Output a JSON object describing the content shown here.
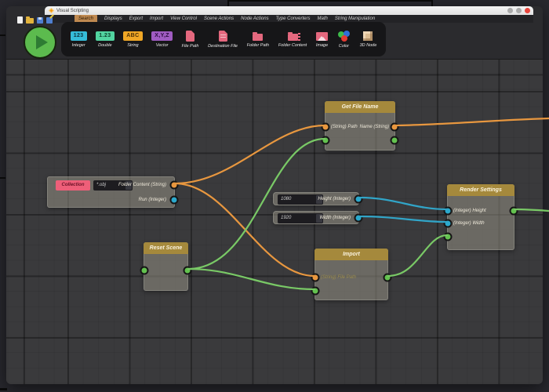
{
  "window": {
    "title": "Visual Scripting"
  },
  "menu": {
    "items": [
      {
        "label": "Search"
      },
      {
        "label": "Displays"
      },
      {
        "label": "Export"
      },
      {
        "label": "Import"
      },
      {
        "label": "View Control"
      },
      {
        "label": "Scene Actions"
      },
      {
        "label": "Node Actions"
      },
      {
        "label": "Type Converters"
      },
      {
        "label": "Math"
      },
      {
        "label": "String Manipulation"
      }
    ]
  },
  "toolbar": {
    "items": [
      {
        "label": "Integer",
        "badge": "123"
      },
      {
        "label": "Double",
        "badge": "1.23"
      },
      {
        "label": "String",
        "badge": "ABC"
      },
      {
        "label": "Vector",
        "badge": "X,Y,Z"
      },
      {
        "label": "File Path"
      },
      {
        "label": "Destination File"
      },
      {
        "label": "Folder Path"
      },
      {
        "label": "Folder Content"
      },
      {
        "label": "Image"
      },
      {
        "label": "Color"
      },
      {
        "label": "3D Node"
      }
    ]
  },
  "canvas": {
    "nodes": {
      "collection": {
        "button_label": "Collection",
        "filter_value": "*.obj",
        "output1": "Folder Content (String)",
        "output2": "Run (Integer)"
      },
      "get_file_name": {
        "title": "Get File Name",
        "input1": "(String) Path",
        "output1": "Name (String)"
      },
      "reset_scene": {
        "title": "Reset Scene"
      },
      "import": {
        "title": "Import",
        "input1": "(String) File Path"
      },
      "render_settings": {
        "title": "Render Settings",
        "input1": "(Integer) Height",
        "input2": "(Integer) Width"
      },
      "height_value": {
        "value": "1080",
        "label": "Height (Integer)"
      },
      "width_value": {
        "value": "1920",
        "label": "Width (Integer)"
      }
    }
  },
  "colors": {
    "node_header_gold": "#a5893c",
    "port_orange": "#e8973f",
    "port_green": "#63c24f",
    "port_cyan": "#2ba8cc",
    "collection_pink": "#ee5f79"
  }
}
